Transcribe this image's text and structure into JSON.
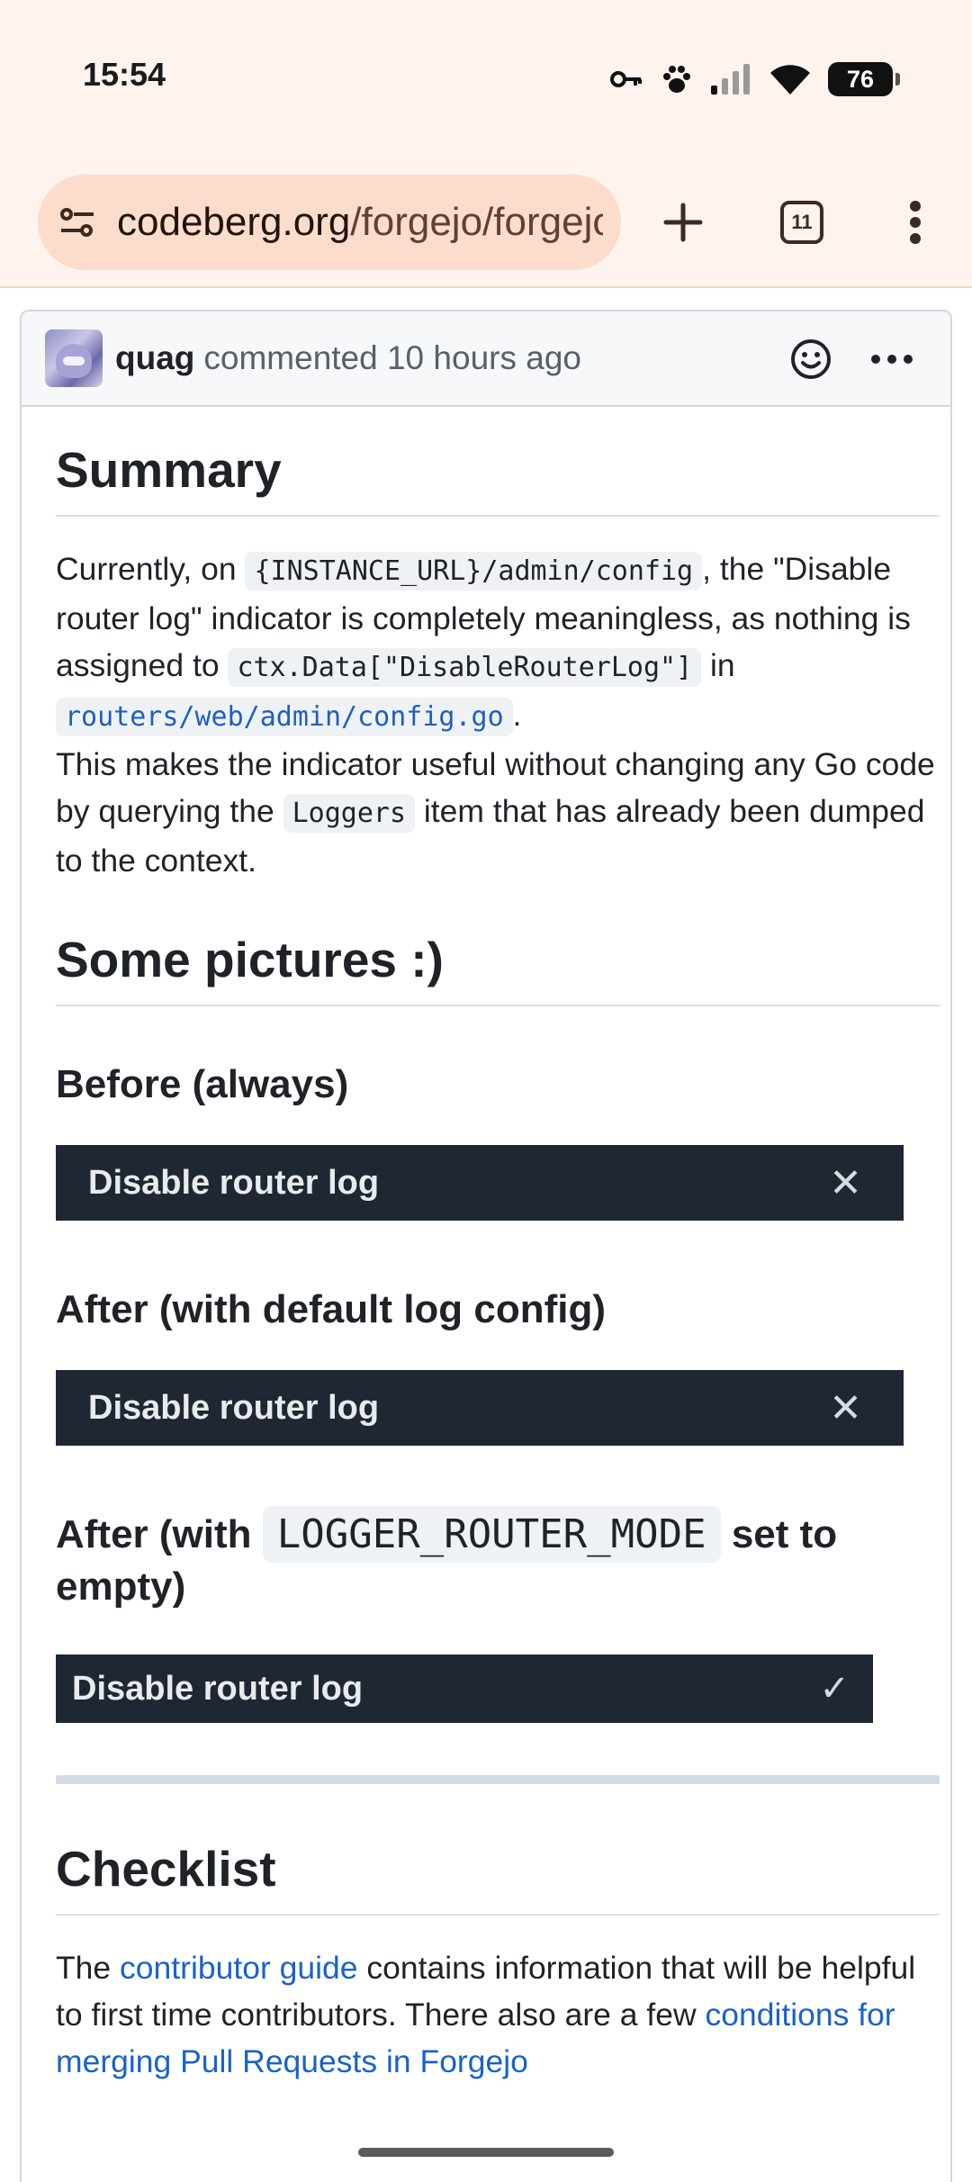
{
  "status_bar": {
    "time": "15:54",
    "battery": "76",
    "icons": [
      "key-icon",
      "paw-icon",
      "signal-icon",
      "wifi-icon",
      "battery-icon"
    ]
  },
  "browser": {
    "url_host": "codeberg.org",
    "url_path": "/forgejo/forgejo",
    "tab_count": "11",
    "accent": "#fcdccb"
  },
  "comment": {
    "author": "quag",
    "meta": "commented 10 hours ago"
  },
  "summary": {
    "heading": "Summary",
    "p1_a": "Currently, on ",
    "p1_code1": "{INSTANCE_URL}/admin/config",
    "p1_b": ", the \"Disable router log\" indicator is completely meaningless, as nothing is assigned to ",
    "p1_code2": "ctx.Data[\"DisableRouterLog\"]",
    "p1_c": " in ",
    "p1_code3": "routers/web/admin/config.go",
    "p1_d": ".",
    "p2_a": "This makes the indicator useful without changing any Go code by querying the ",
    "p2_code": "Loggers",
    "p2_b": " item that has already been dumped to the context."
  },
  "pictures": {
    "heading": "Some pictures :)",
    "before_heading": "Before (always)",
    "after_default_heading": "After (with default log config)",
    "after_empty_a": "After (with ",
    "after_empty_code": "LOGGER_ROUTER_MODE",
    "after_empty_b": " set to empty)",
    "bar_label": "Disable router log",
    "cross": "✕",
    "check": "✓"
  },
  "checklist": {
    "heading": "Checklist",
    "p_a": "The ",
    "link1": "contributor guide",
    "p_b": " contains information that will be helpful to first time contributors. There also are a few ",
    "link2": "conditions for merging Pull Requests in Forgejo"
  }
}
